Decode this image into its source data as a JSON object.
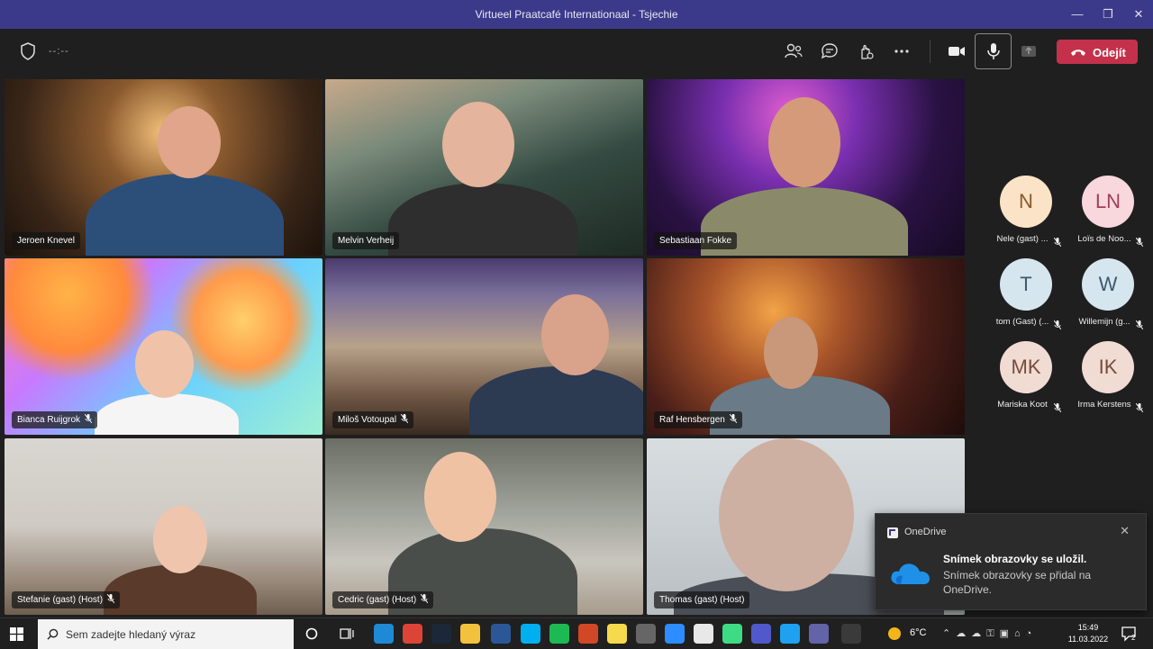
{
  "window": {
    "title": "Virtueel Praatcafé Internationaal - Tsjechie",
    "minimize": "—",
    "maximize": "❐",
    "close": "✕"
  },
  "toolbar": {
    "timer": "--:--",
    "icons": [
      "people-icon",
      "chat-icon",
      "react-icon",
      "more-icon",
      "camera-icon",
      "microphone-icon",
      "share-icon"
    ],
    "leave_label": "Odejít",
    "leave_color": "#c4314b"
  },
  "tiles": [
    {
      "name": "Jeroen Knevel",
      "muted": false,
      "active": true
    },
    {
      "name": "Melvin Verheij",
      "muted": false,
      "active": false
    },
    {
      "name": "Sebastiaan Fokke",
      "muted": false,
      "active": false
    },
    {
      "name": "Bianca Ruijgrok",
      "muted": true,
      "active": false
    },
    {
      "name": "Miloš Votoupal",
      "muted": true,
      "active": false
    },
    {
      "name": "Raf Hensbergen",
      "muted": true,
      "active": false
    },
    {
      "name": "Stefanie (gast) (Host)",
      "muted": true,
      "active": false
    },
    {
      "name": "Cedric (gast) (Host)",
      "muted": true,
      "active": false
    },
    {
      "name": "Thomas (gast) (Host)",
      "muted": false,
      "active": false
    }
  ],
  "roster": [
    {
      "initials": "N",
      "name": "Nele (gast) ...",
      "color": "#fbe3c7",
      "text_color": "#8a5a2a"
    },
    {
      "initials": "LN",
      "name": "Loïs de Noo...",
      "color": "#f8d7dd",
      "text_color": "#a0405a"
    },
    {
      "initials": "T",
      "name": "tom (Gast) (...",
      "color": "#d6e6ef",
      "text_color": "#3c5a6e"
    },
    {
      "initials": "W",
      "name": "Willemijn (g...",
      "color": "#d6e6ef",
      "text_color": "#3c5a6e"
    },
    {
      "initials": "MK",
      "name": "Mariska Koot",
      "color": "#f0dcd3",
      "text_color": "#7a4a3a"
    },
    {
      "initials": "IK",
      "name": "Irma Kerstens",
      "color": "#f0dcd3",
      "text_color": "#7a4a3a"
    }
  ],
  "toast": {
    "app": "OneDrive",
    "heading": "Snímek obrazovky se uložil.",
    "body": "Snímek obrazovky se přidal na OneDrive.",
    "close": "✕"
  },
  "taskbar": {
    "search_placeholder": "Sem zadejte hledaný výraz",
    "weather": "6°C",
    "time": "15:49",
    "date": "11.03.2022",
    "notification_count": "2"
  }
}
